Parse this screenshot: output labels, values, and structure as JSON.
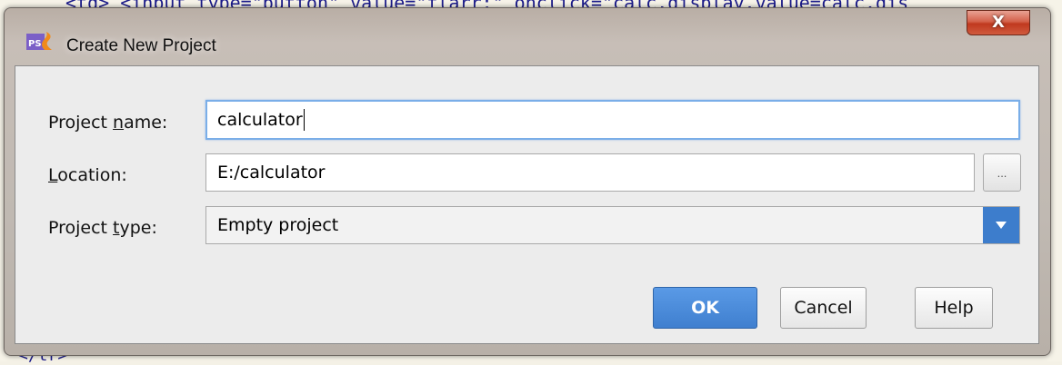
{
  "background": {
    "code_line_top": "<td> <input type=\"button\"  value=\"flarr;\" onclick=\"calc.display.value=calc.dis",
    "code_line_bottom": "</tr>"
  },
  "dialog": {
    "title": "Create New Project",
    "close_glyph": "X",
    "project_name": {
      "label_pre": "Project ",
      "label_underlined": "n",
      "label_post": "ame:",
      "value": "calculator"
    },
    "location": {
      "label_pre": "",
      "label_underlined": "L",
      "label_post": "ocation:",
      "value": "E:/calculator",
      "browse_label": "..."
    },
    "project_type": {
      "label_pre": "Project ",
      "label_underlined": "t",
      "label_post": "ype:",
      "value": "Empty project"
    },
    "buttons": {
      "ok": "OK",
      "cancel": "Cancel",
      "help": "Help"
    }
  },
  "colors": {
    "accent": "#3d7dcc",
    "close_button": "#c7462c",
    "focus_border": "#7aaee8"
  },
  "icons": {
    "app": "phpstorm-icon",
    "close": "close-icon",
    "dropdown": "chevron-down-icon"
  }
}
